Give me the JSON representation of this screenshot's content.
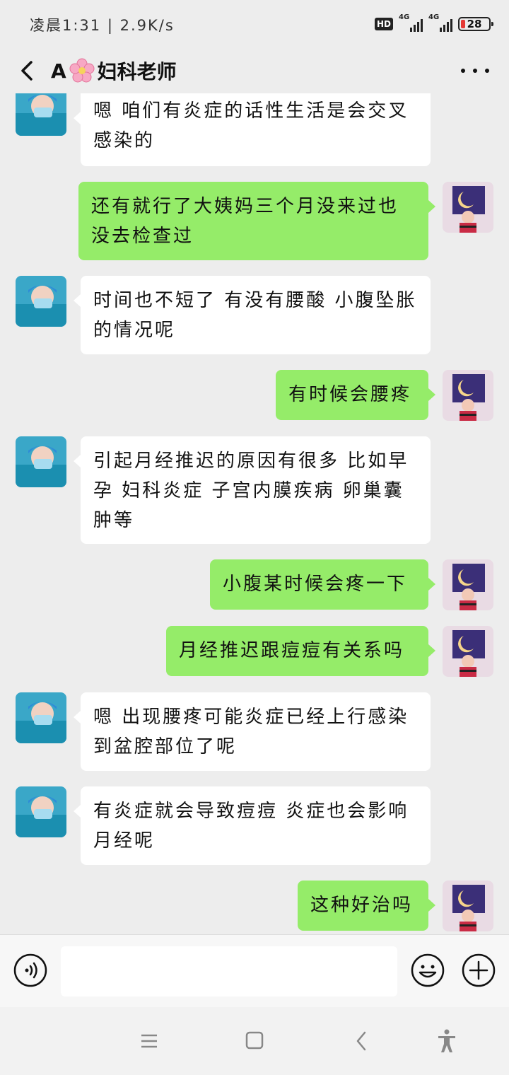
{
  "status_bar": {
    "time_speed": "凌晨1:31 | 2.9K/s",
    "hd": "HD",
    "network1": "4G",
    "network2": "4G",
    "battery": "28"
  },
  "header": {
    "title_prefix": "A",
    "title": "妇科老师"
  },
  "messages": [
    {
      "from": "doctor",
      "text": "嗯 咱们有炎症的话性生活是会交叉感染的"
    },
    {
      "from": "me",
      "text": "还有就行了大姨妈三个月没来过也没去检查过"
    },
    {
      "from": "doctor",
      "text": "时间也不短了 有没有腰酸 小腹坠胀的情况呢"
    },
    {
      "from": "me",
      "text": "有时候会腰疼"
    },
    {
      "from": "doctor",
      "text": "引起月经推迟的原因有很多 比如早孕 妇科炎症 子宫内膜疾病 卵巢囊肿等"
    },
    {
      "from": "me",
      "text": "小腹某时候会疼一下"
    },
    {
      "from": "me",
      "text": "月经推迟跟痘痘有关系吗"
    },
    {
      "from": "doctor",
      "text": "嗯 出现腰疼可能炎症已经上行感染到盆腔部位了呢"
    },
    {
      "from": "doctor",
      "text": "有炎症就会导致痘痘 炎症也会影响月经呢"
    },
    {
      "from": "me",
      "text": "这种好治吗"
    }
  ],
  "input": {
    "value": ""
  },
  "colors": {
    "background": "#ededed",
    "outgoing_bubble": "#95ec69",
    "incoming_bubble": "#ffffff"
  }
}
